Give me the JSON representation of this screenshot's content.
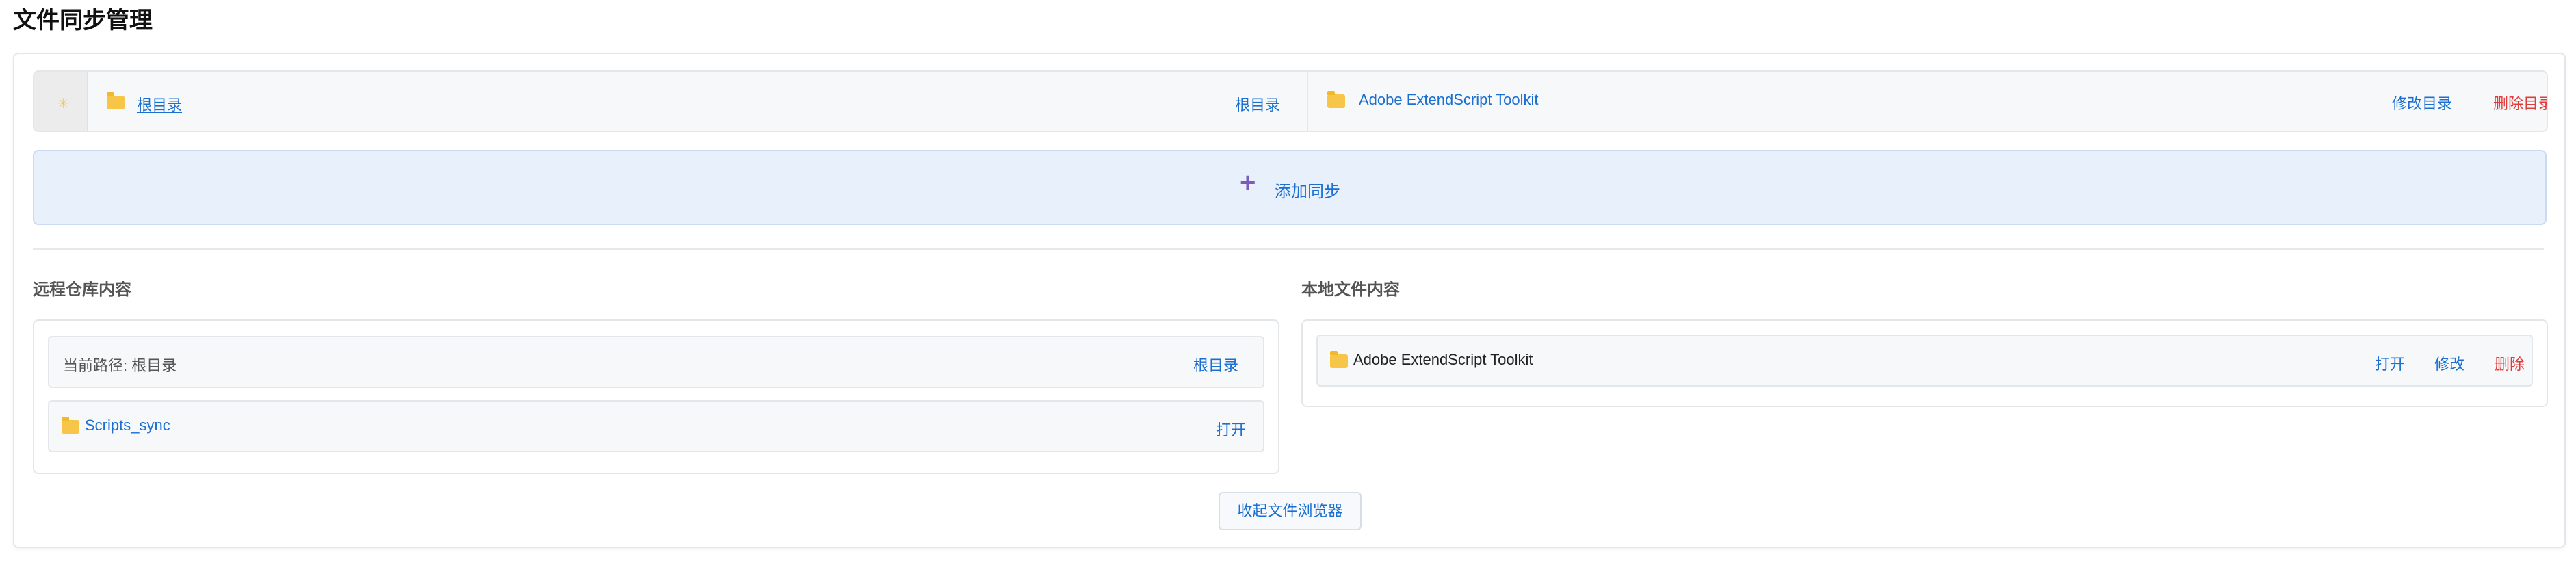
{
  "page": {
    "title": "文件同步管理"
  },
  "sync_pair": {
    "remote_name": "根目录",
    "remote_action": "根目录",
    "local_name": "Adobe ExtendScript Toolkit",
    "edit_label": "修改目录",
    "delete_label": "删除目录"
  },
  "add_sync": {
    "label": "添加同步"
  },
  "remote": {
    "title": "远程仓库内容",
    "path_label": "当前路径: 根目录",
    "root_link": "根目录",
    "items": [
      {
        "name": "Scripts_sync",
        "open_label": "打开"
      }
    ]
  },
  "local": {
    "title": "本地文件内容",
    "items": [
      {
        "name": "Adobe ExtendScript Toolkit",
        "open_label": "打开",
        "edit_label": "修改",
        "delete_label": "删除"
      }
    ]
  },
  "collapse_label": "收起文件浏览器",
  "colors": {
    "accent": "#1a6fd1",
    "danger": "#e03b3b",
    "folder": "#f7c548",
    "add_bg": "#e8f0fc"
  }
}
